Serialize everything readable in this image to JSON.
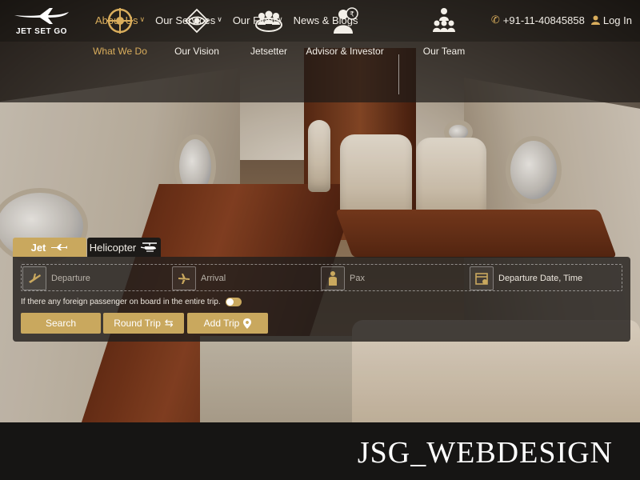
{
  "brand": {
    "name": "JET SET GO",
    "accent": "#c9a85e"
  },
  "topnav": {
    "items": [
      {
        "label": "About Us",
        "has_dropdown": true,
        "active": true
      },
      {
        "label": "Our Services",
        "has_dropdown": true,
        "active": false
      },
      {
        "label": "Our Fleet",
        "has_dropdown": true,
        "active": false
      },
      {
        "label": "News & Blogs",
        "has_dropdown": false,
        "active": false
      }
    ],
    "phone": "+91-11-40845858",
    "login": "Log In"
  },
  "subnav": {
    "items": [
      {
        "label": "What We Do",
        "icon": "compass-icon",
        "active": true
      },
      {
        "label": "Our Vision",
        "icon": "eye-icon",
        "active": false
      },
      {
        "label": "Jetsetter",
        "icon": "group-icon",
        "active": false
      },
      {
        "label": "Advisor & Investor",
        "icon": "advisor-icon",
        "active": false
      },
      {
        "label": "Our Team",
        "icon": "team-icon",
        "active": false
      }
    ]
  },
  "booking": {
    "tabs": {
      "jet": "Jet",
      "helicopter": "Helicopter"
    },
    "fields": {
      "departure": "Departure",
      "arrival": "Arrival",
      "pax": "Pax",
      "date": "Departure Date, Time"
    },
    "foreign_text": "If there any foreign passenger on board in the entire trip.",
    "buttons": {
      "search": "Search",
      "round_trip": "Round Trip",
      "add_trip": "Add Trip"
    }
  },
  "footer": {
    "watermark": "JSG_WEBDESIGN"
  }
}
